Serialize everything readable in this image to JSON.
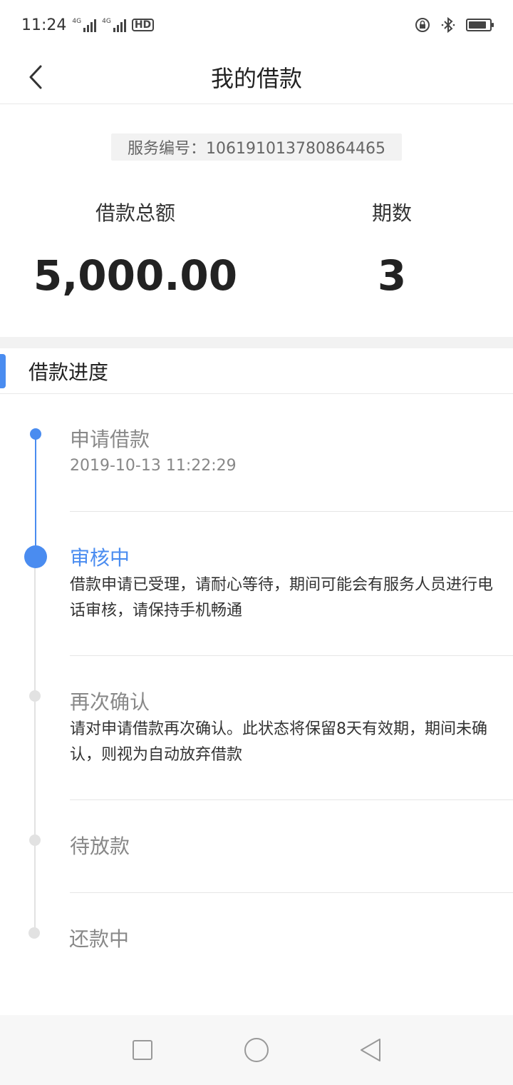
{
  "status_bar": {
    "time": "11:24",
    "signal_1_label": "4G",
    "signal_2_label": "4G",
    "hd_label": "HD",
    "icons": [
      "screen-lock-icon",
      "bluetooth-icon",
      "battery-icon"
    ],
    "battery_level": 0.85
  },
  "header": {
    "title": "我的借款",
    "back_icon": "chevron-left-icon"
  },
  "summary": {
    "service_number_label": "服务编号：106191013780864465",
    "amount_label": "借款总额",
    "amount_value": "5,000.00",
    "periods_label": "期数",
    "periods_value": "3"
  },
  "progress": {
    "section_title": "借款进度",
    "steps": [
      {
        "title": "申请借款",
        "time": "2019-10-13 11:22:29",
        "state": "done"
      },
      {
        "title": "审核中",
        "description": "借款申请已受理，请耐心等待，期间可能会有服务人员进行电话审核，请保持手机畅通",
        "state": "active"
      },
      {
        "title": "再次确认",
        "description": "请对申请借款再次确认。此状态将保留8天有效期，期间未确认，则视为自动放弃借款",
        "state": "pending"
      },
      {
        "title": "待放款",
        "state": "pending"
      },
      {
        "title": "还款中",
        "state": "pending"
      }
    ]
  },
  "colors": {
    "accent": "#4a8cf0",
    "pending": "#e2e2e2",
    "muted_text": "#888888"
  },
  "nav_bar": {
    "icons": [
      "recent-apps-icon",
      "home-icon",
      "back-triangle-icon"
    ]
  }
}
